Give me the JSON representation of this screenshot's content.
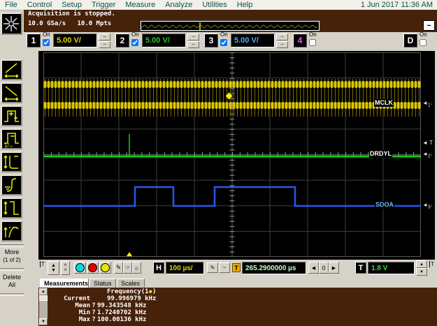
{
  "menu": {
    "items": [
      "File",
      "Control",
      "Setup",
      "Trigger",
      "Measure",
      "Analyze",
      "Utilities",
      "Help"
    ],
    "datetime": "1 Jun 2017 11:36 AM"
  },
  "status": {
    "line1": "Acquisition is stopped.",
    "line2": "10.0 GSa/s   10.0 Mpts",
    "minimize_label": "−"
  },
  "channels": [
    {
      "num": "1",
      "on_label": "On",
      "scale": "5.00 V/",
      "scale_style": "color:#d9d900",
      "num_style": "color:#ffffff",
      "checked": true,
      "wave_glyph": "~"
    },
    {
      "num": "2",
      "on_label": "On",
      "scale": "5.00 V/",
      "scale_style": "color:#22cc22",
      "num_style": "color:#ffffff",
      "checked": true,
      "wave_glyph": "~"
    },
    {
      "num": "3",
      "on_label": "On",
      "scale": "5.00 V/",
      "scale_style": "color:#55aaff",
      "num_style": "color:#ffffff",
      "checked": true,
      "wave_glyph": "~"
    },
    {
      "num": "4",
      "on_label": "On",
      "num_style": "color:#ff4dff",
      "checked": false
    },
    {
      "num": "D",
      "on_label": "On",
      "num_style": "color:#ffffff",
      "checked": false
    }
  ],
  "sidebar": {
    "icons": [
      "agilent-logo",
      "rise-time",
      "fall-time",
      "positive-width",
      "frequency",
      "v-min",
      "v-base",
      "v-peak-peak",
      "v-average"
    ],
    "more_line1": "More",
    "more_line2": "(1 of 2)",
    "delete_line1": "Delete",
    "delete_line2": "All"
  },
  "scope": {
    "labels": [
      {
        "text": "MCLK",
        "style": "color:#ffffff"
      },
      {
        "text": "DRDYL",
        "style": "color:#ffffff"
      },
      {
        "text": "SDOA",
        "style": "color:#66bbff"
      }
    ],
    "markers": [
      {
        "arrow": "◄",
        "label": "1",
        "dir": "↓"
      },
      {
        "arrow": "◄",
        "label": "T",
        "dir": ""
      },
      {
        "arrow": "◄",
        "label": "2",
        "dir": "↓"
      },
      {
        "arrow": "◄",
        "label": "3",
        "dir": "↓"
      }
    ],
    "channel_names": [
      "MCLK (ch1, yellow clock)",
      "DRDYL (ch2, green)",
      "SDOA (ch3, blue data)"
    ],
    "trigger_pointer": "▲"
  },
  "toolbar": {
    "left_trig_marker": "T",
    "right_trig_marker": "T",
    "spin_up": "▲",
    "spin_down": "▼",
    "chev_up": "˄",
    "chev_down": "˅",
    "circle_colors": [
      "background:#00dcdc",
      "background:#e00000",
      "background:#e8e800"
    ],
    "draw_icon": "✎",
    "hand_icon": "☞",
    "brightness_icon": "☼",
    "h_label": "H",
    "timebase": "100 µs/",
    "cursor_icon": "✎",
    "wave_icon": "~",
    "t_badge": "T",
    "delay": "265.2900000 µs",
    "prev": "◀",
    "zero": "0",
    "next": "▶",
    "trig_label": "T",
    "trig_level": "1.8 V"
  },
  "tabs": [
    "Measurements",
    "Status",
    "Scales"
  ],
  "measurements": {
    "title_pre": "Frequency(1",
    "title_diamond": "◆",
    "title_post": ")",
    "rows": [
      {
        "label": "Current",
        "flag": "",
        "value": "99.996979 kHz"
      },
      {
        "label": "Mean",
        "flag": "?",
        "value": "99.343548 kHz"
      },
      {
        "label": "Min",
        "flag": "?",
        "value": "1.7240702 kHz"
      },
      {
        "label": "Max",
        "flag": "?",
        "value": "100.00136 kHz"
      }
    ]
  }
}
